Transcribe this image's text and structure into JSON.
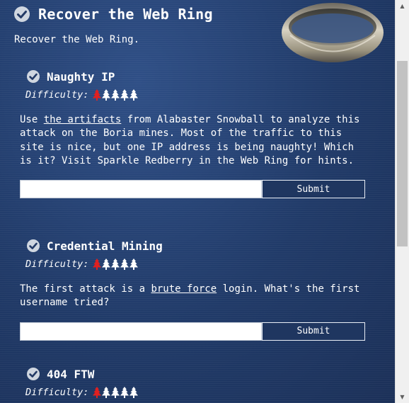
{
  "header": {
    "title": "Recover the Web Ring",
    "subtitle": "Recover the Web Ring."
  },
  "objectives": [
    {
      "title": "Naughty IP",
      "difficulty_label": "Difficulty:",
      "difficulty_level": 1,
      "difficulty_max": 5,
      "desc_pre": "Use ",
      "desc_link": "the artifacts",
      "desc_post": " from Alabaster Snowball to analyze this attack on the Boria mines. Most of the traffic to this site is nice, but one IP address is being naughty! Which is it? Visit Sparkle Redberry in the Web Ring for hints.",
      "answer_value": "",
      "submit_label": "Submit"
    },
    {
      "title": "Credential Mining",
      "difficulty_label": "Difficulty:",
      "difficulty_level": 1,
      "difficulty_max": 5,
      "desc_pre": "The first attack is a ",
      "desc_link": "brute force",
      "desc_post": " login. What's the first username tried?",
      "answer_value": "",
      "submit_label": "Submit"
    },
    {
      "title": "404 FTW",
      "difficulty_label": "Difficulty:",
      "difficulty_level": 1,
      "difficulty_max": 5
    }
  ],
  "colors": {
    "tree_active": "#e02020",
    "tree_inactive": "#ffffff",
    "panel_bg": "#233a66"
  },
  "icons": {
    "completed": "check-circle-icon",
    "difficulty": "tree-icon",
    "ring": "ring-image"
  }
}
